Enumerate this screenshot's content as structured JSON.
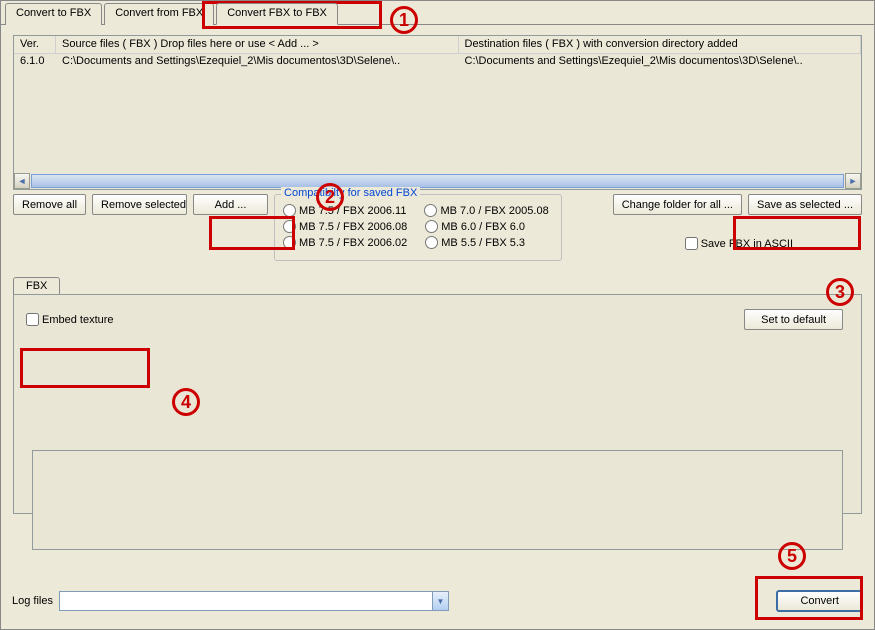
{
  "tabs": {
    "t0": "Convert to FBX",
    "t1": "Convert from FBX",
    "t2": "Convert FBX to FBX"
  },
  "table": {
    "headers": {
      "ver": "Ver.",
      "src": "Source files ( FBX )       Drop files here or use < Add ... >",
      "dst": "Destination files ( FBX ) with conversion directory added"
    },
    "row": {
      "ver": "6.1.0",
      "src": "C:\\Documents and Settings\\Ezequiel_2\\Mis documentos\\3D\\Selene\\..",
      "dst": "C:\\Documents and Settings\\Ezequiel_2\\Mis documentos\\3D\\Selene\\.."
    }
  },
  "buttons": {
    "remove_all": "Remove all",
    "remove_selected": "Remove selected",
    "add": "Add ...",
    "change_folder": "Change folder for all ...",
    "save_as_selected": "Save as selected ...",
    "set_default": "Set to default",
    "convert": "Convert"
  },
  "compat": {
    "title": "Compatibilty for saved FBX",
    "r0": "MB 7.5 / FBX 2006.11",
    "r1": "MB 7.0 / FBX 2005.08",
    "r2": "MB 7.5 / FBX 2006.08",
    "r3": "MB 6.0 / FBX 6.0",
    "r4": "MB 7.5 / FBX 2006.02",
    "r5": "MB 5.5 / FBX 5.3"
  },
  "checks": {
    "save_ascii": "Save FBX in ASCII",
    "embed_texture": "Embed texture"
  },
  "subtab": "FBX",
  "logfiles_label": "Log files",
  "annotations": {
    "a1": "1",
    "a2": "2",
    "a3": "3",
    "a4": "4",
    "a5": "5"
  }
}
